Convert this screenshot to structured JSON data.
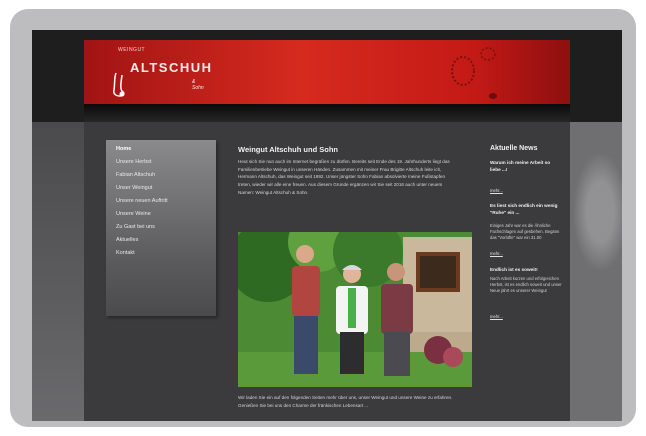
{
  "site": {
    "logo_top": "WEINGUT",
    "logo_main": "ALTSCHUH",
    "logo_sub": "& Sohn"
  },
  "nav": {
    "items": [
      {
        "label": "Home",
        "active": true
      },
      {
        "label": "Unsere Herbst"
      },
      {
        "label": "Fabian Altschuh"
      },
      {
        "label": "Unser Weingut"
      },
      {
        "label": "Unsere neuen Auftritt"
      },
      {
        "label": "Unsere Weine"
      },
      {
        "label": "Zu Gast bei uns"
      },
      {
        "label": "Aktuelles"
      },
      {
        "label": "Kontakt"
      }
    ]
  },
  "main": {
    "title": "Weingut Altschuh und Sohn",
    "intro": "Heut sich Sie nun auch im Internet begrüßen zu dürfen. Bereits seit Ende des 19. Jahrhunderts liegt das Familienbetriebe Weingut in unseren Händen. Zusammen mit meiner Frau Brigitte Altschuh leite ich, Hermann Altschuh, das Weingut seit 1992. Unser jüngster Sohn Fabian absolvierte meine Fußstapfen treten, wieder wir alle eine freuen. Aus diesem Grunde ergänzen wir Sie seit 2016 auch unter neuem Namen: Weingut Altschuh & Sohn.",
    "outro": "Wir laden Sie ein auf den folgenden Seiten mehr über uns, unser Weingut und unsere Weine zu erfahren. Genießen Sie bei uns den Charme der fränkischen Lebensart ..."
  },
  "sidebar": {
    "title": "Aktuelle News",
    "news": [
      {
        "title": "Warum ich meine Arbeit so liebe ...!",
        "text": "",
        "more": "mehr..."
      },
      {
        "title": "Es liest sich endlich ein wenig \"Ruhe\" ein ...",
        "text": "Einiges Jahr war es die Ähnliche Fachschlagen auf gesbehen. Begänn das \"Vorlüfte\" war ein 31.00",
        "more": "mehr..."
      },
      {
        "title": "Endlich ist es soweit!",
        "text": "Nach Arbeit kurzen und erfolgreichen Herbst, ist es endlich soweit und unser Neue jährt es unserer Weingut",
        "more": "mehr..."
      }
    ]
  },
  "colors": {
    "header_red": "#d62a1e",
    "page_bg": "#3b3b3d",
    "frame": "#bdbdc0"
  }
}
